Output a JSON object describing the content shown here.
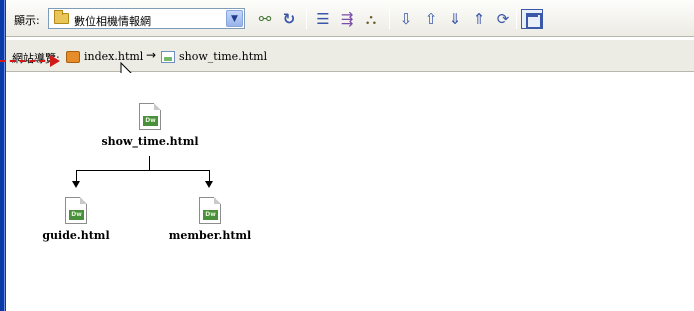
{
  "toolbar": {
    "show_label": "顯示:",
    "site_select": {
      "value": "數位相機情報網"
    },
    "icons": [
      "connect-icon",
      "refresh-icon",
      "view-options-icon",
      "expand-collapse-icon",
      "site-map-icon",
      "get-icon",
      "put-icon",
      "check-in-icon",
      "check-out-icon",
      "synchronize-icon",
      "window-icon"
    ]
  },
  "breadcrumb": {
    "label": "網站導覽:",
    "items": [
      {
        "label": "index.html"
      },
      {
        "label": "show_time.html"
      }
    ]
  },
  "site_map": {
    "root": {
      "name": "show_time.html",
      "badge": "Dw"
    },
    "children": [
      {
        "name": "guide.html",
        "badge": "Dw"
      },
      {
        "name": "member.html",
        "badge": "Dw"
      }
    ]
  }
}
